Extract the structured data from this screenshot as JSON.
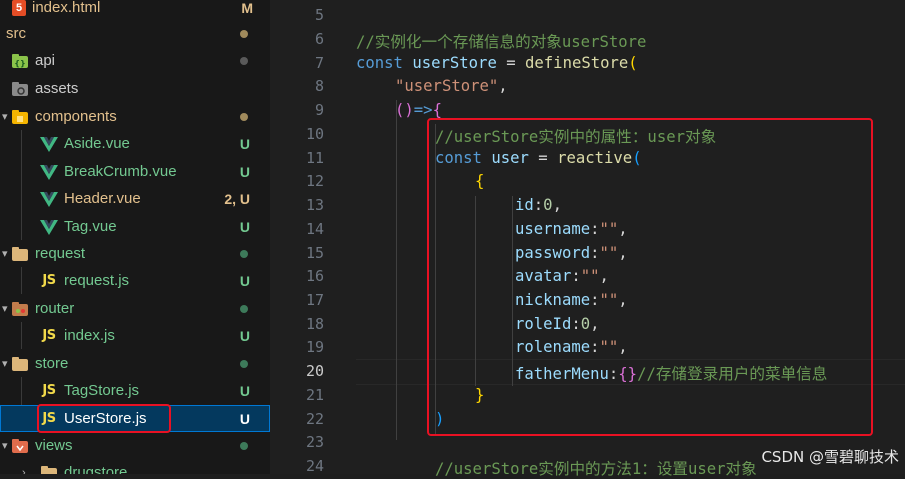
{
  "explorer": {
    "items": [
      {
        "label": "index.html",
        "status": "M",
        "icon": "html5-icon"
      },
      {
        "label": "src",
        "status": "",
        "icon": "none"
      },
      {
        "label": "api",
        "status": "",
        "icon": "api-folder-icon"
      },
      {
        "label": "assets",
        "status": "",
        "icon": "assets-folder-icon"
      },
      {
        "label": "components",
        "status": "",
        "icon": "components-folder-icon"
      },
      {
        "label": "Aside.vue",
        "status": "U",
        "icon": "vue-icon"
      },
      {
        "label": "BreakCrumb.vue",
        "status": "U",
        "icon": "vue-icon"
      },
      {
        "label": "Header.vue",
        "status": "2, U",
        "icon": "vue-icon"
      },
      {
        "label": "Tag.vue",
        "status": "U",
        "icon": "vue-icon"
      },
      {
        "label": "request",
        "status": "",
        "icon": "folder-icon"
      },
      {
        "label": "request.js",
        "status": "U",
        "icon": "js-icon"
      },
      {
        "label": "router",
        "status": "",
        "icon": "router-folder-icon"
      },
      {
        "label": "index.js",
        "status": "U",
        "icon": "js-icon"
      },
      {
        "label": "store",
        "status": "",
        "icon": "folder-icon"
      },
      {
        "label": "TagStore.js",
        "status": "U",
        "icon": "js-icon"
      },
      {
        "label": "UserStore.js",
        "status": "U",
        "icon": "js-icon"
      },
      {
        "label": "views",
        "status": "",
        "icon": "views-folder-icon"
      },
      {
        "label": "drugstore",
        "status": "",
        "icon": "folder-icon"
      }
    ],
    "js_icon_text": "JS",
    "html5_icon_text": "5"
  },
  "editor": {
    "line_numbers": [
      "5",
      "6",
      "7",
      "8",
      "9",
      "10",
      "11",
      "12",
      "13",
      "14",
      "15",
      "16",
      "17",
      "18",
      "19",
      "20",
      "21",
      "22",
      "23",
      "24"
    ],
    "active_line": "20",
    "lines": {
      "l6": "//实例化一个存储信息的对象userStore",
      "l7_const": "const",
      "l7_name": "userStore",
      "l7_eq": " = ",
      "l7_fn": "defineStore",
      "l7_paren": "(",
      "l8_str": "\"userStore\"",
      "l8_comma": ",",
      "l9_paren": "()",
      "l9_arrow": "=>",
      "l9_brace": "{",
      "l10": "//userStore实例中的属性：user对象",
      "l11_const": "const",
      "l11_name": "user",
      "l11_eq": " = ",
      "l11_fn": "reactive",
      "l11_paren": "(",
      "l12": "{",
      "l13_key": "id",
      "l13_colon": ":",
      "l13_val": "0",
      "l13_comma": ",",
      "l14_key": "username",
      "l14_val": "\"\"",
      "l15_key": "password",
      "l15_val": "\"\"",
      "l16_key": "avatar",
      "l16_val": "\"\"",
      "l17_key": "nickname",
      "l17_val": "\"\"",
      "l18_key": "roleId",
      "l18_val": "0",
      "l19_key": "rolename",
      "l19_val": "\"\"",
      "l20_key": "fatherMenu",
      "l20_val": "{}",
      "l20_comment": "//存储登录用户的菜单信息",
      "l21": "}",
      "l22": ")",
      "l24": "//userStore实例中的方法1：设置user对象"
    },
    "colon": ":",
    "comma": ","
  },
  "watermark": "CSDN @雪碧聊技术",
  "colors": {
    "highlight_box": "#e81123",
    "modified": "#e2c08d",
    "untracked": "#73c991",
    "folder": "#dcb67a"
  }
}
